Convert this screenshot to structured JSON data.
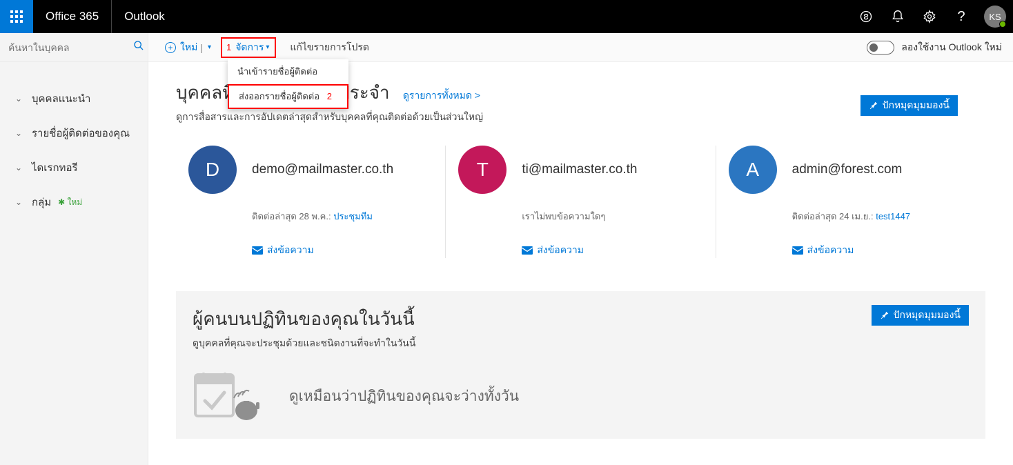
{
  "top": {
    "brand": "Office 365",
    "product": "Outlook",
    "avatar_initials": "KS"
  },
  "search": {
    "placeholder": "ค้นหาในบุคคล"
  },
  "nav": {
    "item1": "บุคคลแนะนำ",
    "item2": "รายชื่อผู้ติดต่อของคุณ",
    "item3": "ไดเรกทอรี",
    "item4": "กลุ่ม",
    "new_badge": "✱ ใหม่"
  },
  "toolbar": {
    "new": "ใหม่",
    "manage": "จัดการ",
    "fav": "แก้ไขรายการโปรด",
    "try_label": "ลองใช้งาน Outlook ใหม่",
    "annot1": "1",
    "annot2": "2",
    "dropdown": {
      "import": "นำเข้ารายชื่อผู้ติดต่อ",
      "export": "ส่งออกรายชื่อผู้ติดต่อ"
    }
  },
  "section_freq": {
    "title": "บุคคลที่คุณติดต่อเป็นประจำ",
    "view_all": "ดูรายการทั้งหมด >",
    "sub": "ดูการสื่อสารและการอัปเดตล่าสุดสำหรับบุคคลที่คุณติดต่อด้วยเป็นส่วนใหญ่",
    "pin": "ปักหมุดมุมมองนี้"
  },
  "contacts": [
    {
      "initial": "D",
      "color": "#2b579a",
      "email": "demo@mailmaster.co.th",
      "meta_prefix": "ติดต่อล่าสุด 28 พ.ค.: ",
      "meta_link": "ประชุมทีม",
      "send": "ส่งข้อความ"
    },
    {
      "initial": "T",
      "color": "#c3185a",
      "email": "ti@mailmaster.co.th",
      "meta_prefix": "เราไม่พบข้อความใดๆ",
      "meta_link": "",
      "send": "ส่งข้อความ"
    },
    {
      "initial": "A",
      "color": "#2b76c1",
      "email": "admin@forest.com",
      "meta_prefix": "ติดต่อล่าสุด 24 เม.ย.: ",
      "meta_link": "test1447",
      "send": "ส่งข้อความ"
    }
  ],
  "section_cal": {
    "title": "ผู้คนบนปฏิทินของคุณในวันนี้",
    "sub": "ดูบุคคลที่คุณจะประชุมด้วยและชนิดงานที่จะทำในวันนี้",
    "pin": "ปักหมุดมุมมองนี้",
    "empty": "ดูเหมือนว่าปฏิทินของคุณจะว่างทั้งวัน"
  }
}
